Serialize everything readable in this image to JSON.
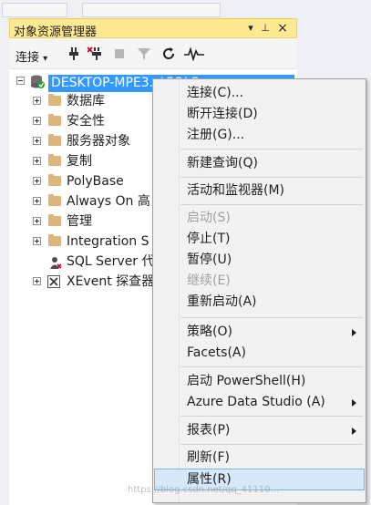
{
  "panel": {
    "title": "对象资源管理器",
    "dropdown_glyph": "▾",
    "pin_glyph": "⊥",
    "close_glyph": "×"
  },
  "toolbar": {
    "connect_label": "连接",
    "connect_arrow": "▾",
    "icons": [
      "plug-icon",
      "disconnect-plug-icon",
      "stop-icon",
      "filter-icon",
      "refresh-icon",
      "activity-pulse-icon"
    ]
  },
  "tree": {
    "root": "DESKTOP-MPE3...\\SQLS...",
    "items": [
      {
        "label": "数据库",
        "kind": "folder"
      },
      {
        "label": "安全性",
        "kind": "folder"
      },
      {
        "label": "服务器对象",
        "kind": "folder"
      },
      {
        "label": "复制",
        "kind": "folder"
      },
      {
        "label": "PolyBase",
        "kind": "folder"
      },
      {
        "label": "Always On 高",
        "kind": "folder"
      },
      {
        "label": "管理",
        "kind": "folder"
      },
      {
        "label": "Integration S",
        "kind": "folder"
      },
      {
        "label": "SQL Server 代",
        "kind": "agent"
      },
      {
        "label": "XEvent 探查器",
        "kind": "xevent"
      }
    ]
  },
  "context_menu": {
    "items": [
      {
        "label": "连接(C)...",
        "enabled": true
      },
      {
        "label": "断开连接(D)",
        "enabled": true
      },
      {
        "label": "注册(G)...",
        "enabled": true
      },
      {
        "label": "新建查询(Q)",
        "enabled": true
      },
      {
        "label": "活动和监视器(M)",
        "enabled": true
      },
      {
        "label": "启动(S)",
        "enabled": false
      },
      {
        "label": "停止(T)",
        "enabled": true
      },
      {
        "label": "暂停(U)",
        "enabled": true
      },
      {
        "label": "继续(E)",
        "enabled": false
      },
      {
        "label": "重新启动(A)",
        "enabled": true
      },
      {
        "label": "策略(O)",
        "enabled": true,
        "submenu": true
      },
      {
        "label": "Facets(A)",
        "enabled": true
      },
      {
        "label": "启动 PowerShell(H)",
        "enabled": true
      },
      {
        "label": "Azure Data Studio (A)",
        "enabled": true,
        "submenu": true
      },
      {
        "label": "报表(P)",
        "enabled": true,
        "submenu": true
      },
      {
        "label": "刷新(F)",
        "enabled": true
      },
      {
        "label": "属性(R)",
        "enabled": true,
        "highlighted": true
      }
    ]
  },
  "watermark": "https://blog.csdn.net/qq_41110...",
  "colors": {
    "title_bar": "#ffe992",
    "selection": "#3399ff",
    "menu_highlight": "#d7e9f8",
    "folder": "#dcb67a"
  }
}
